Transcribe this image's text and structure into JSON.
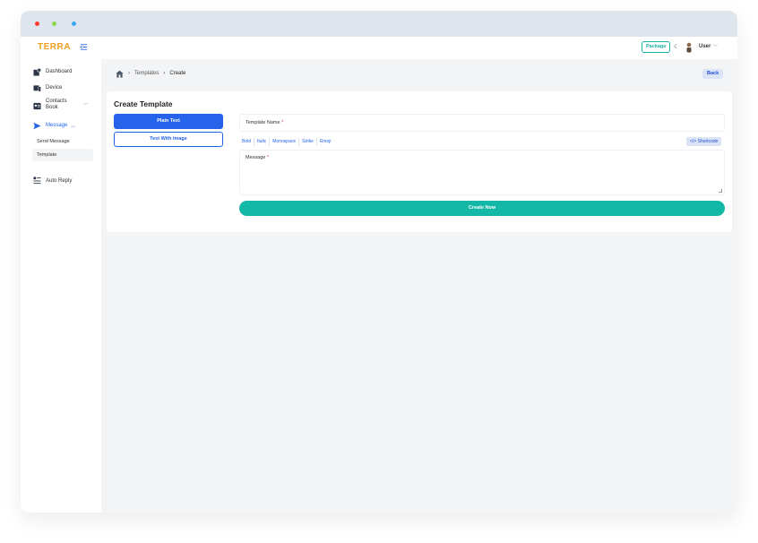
{
  "window": {
    "dots": [
      "#ff3b30",
      "#8bd94a",
      "#38a9f0"
    ]
  },
  "topbar": {
    "logo": "TERRA",
    "package_label": "Package",
    "user_label": "User"
  },
  "sidebar": {
    "items": [
      {
        "label": "Dashboard",
        "icon": "dashboard-icon"
      },
      {
        "label": "Device",
        "icon": "device-icon"
      },
      {
        "label": "Contacts Book",
        "icon": "contacts-icon"
      },
      {
        "label": "Message",
        "icon": "send-icon"
      },
      {
        "label": "Auto Reply",
        "icon": "auto-reply-icon"
      }
    ],
    "message_sub": [
      "Send Message",
      "Template"
    ]
  },
  "breadcrumb": {
    "items": [
      "Templates",
      "Create"
    ]
  },
  "back_label": "Back",
  "form": {
    "title": "Create Template",
    "type_plain": "Plain Text",
    "type_image": "Text With Image",
    "template_name_label": "Template Name",
    "required_mark": "*",
    "format_buttons": [
      "Bold",
      "Italic",
      "Monospace",
      "Strike",
      "Emoji"
    ],
    "shortcode_label": "Shortcode",
    "shortcode_symbol": "</>",
    "message_label": "Message",
    "submit_label": "Create Now"
  },
  "colors": {
    "primary": "#2563eb",
    "accent": "#14b8a6",
    "logo": "#f0a020"
  }
}
